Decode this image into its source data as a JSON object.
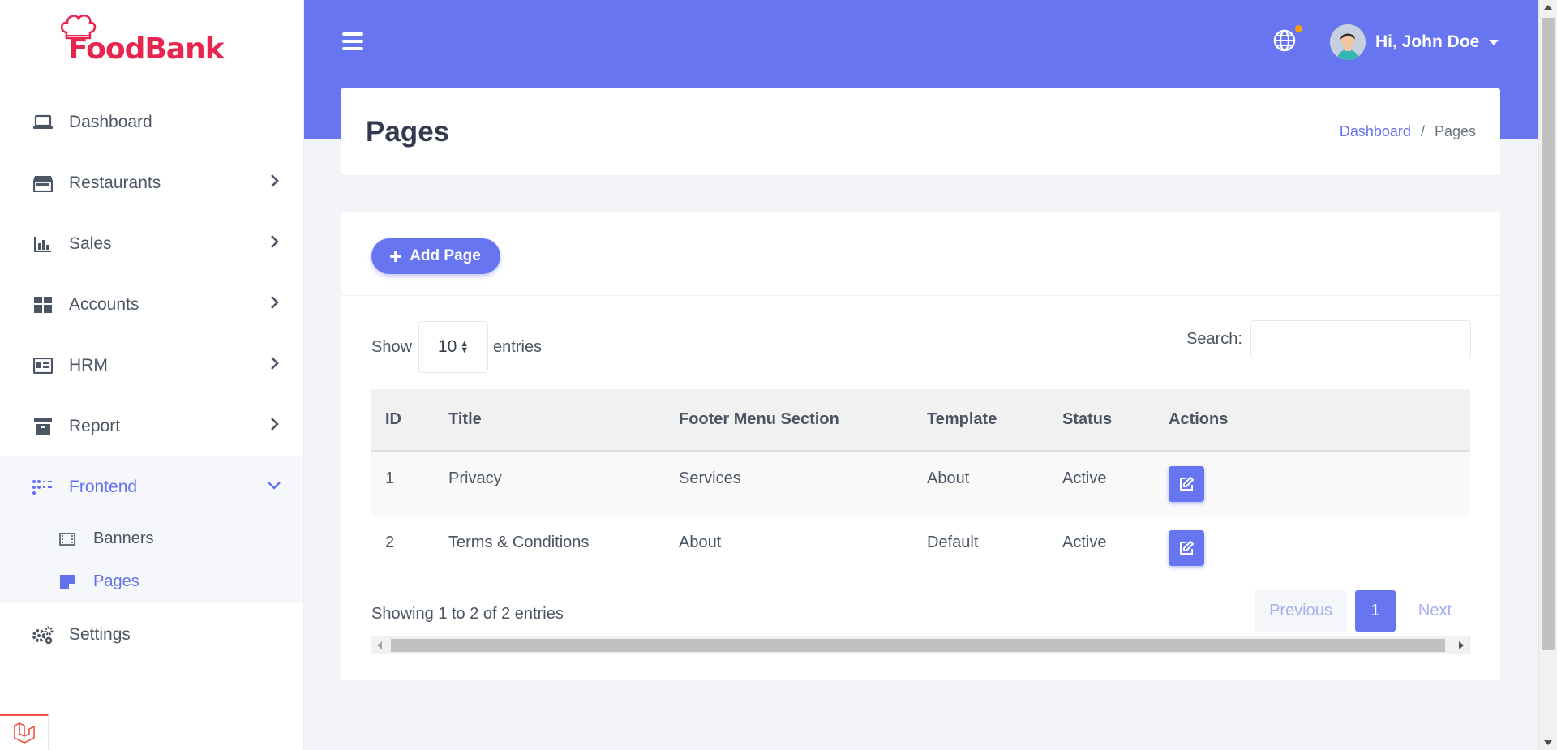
{
  "brand": {
    "name": "FoodBank",
    "color": "#e8254f",
    "accent": "#6776f0"
  },
  "sidebar": {
    "items": [
      {
        "label": "Dashboard",
        "icon": "laptop-icon"
      },
      {
        "label": "Restaurants",
        "icon": "store-icon",
        "has_children": true
      },
      {
        "label": "Sales",
        "icon": "bar-chart-icon",
        "has_children": true
      },
      {
        "label": "Accounts",
        "icon": "grid-icon",
        "has_children": true
      },
      {
        "label": "HRM",
        "icon": "id-card-icon",
        "has_children": true
      },
      {
        "label": "Report",
        "icon": "archive-icon",
        "has_children": true
      },
      {
        "label": "Frontend",
        "icon": "dots-grid-icon",
        "expanded": true,
        "active": true
      },
      {
        "label": "Settings",
        "icon": "gears-icon"
      }
    ],
    "frontend_children": [
      {
        "label": "Banners",
        "icon": "film-icon"
      },
      {
        "label": "Pages",
        "icon": "sticky-note-icon",
        "active": true
      }
    ]
  },
  "header": {
    "user_greeting": "Hi, John Doe",
    "language_icon": "globe-icon"
  },
  "page": {
    "title": "Pages",
    "breadcrumb": {
      "home": "Dashboard",
      "separator": "/",
      "current": "Pages"
    }
  },
  "toolbar": {
    "add_label": "Add Page"
  },
  "datatable": {
    "show_label": "Show",
    "entries_label": "entries",
    "page_size": "10",
    "search_label": "Search:",
    "search_value": "",
    "columns": [
      "ID",
      "Title",
      "Footer Menu Section",
      "Template",
      "Status",
      "Actions"
    ],
    "rows": [
      {
        "id": "1",
        "title": "Privacy",
        "footer_menu_section": "Services",
        "template": "About",
        "status": "Active"
      },
      {
        "id": "2",
        "title": "Terms & Conditions",
        "footer_menu_section": "About",
        "template": "Default",
        "status": "Active"
      }
    ],
    "info": "Showing 1 to 2 of 2 entries",
    "pagination": {
      "previous": "Previous",
      "current": "1",
      "next": "Next"
    }
  }
}
